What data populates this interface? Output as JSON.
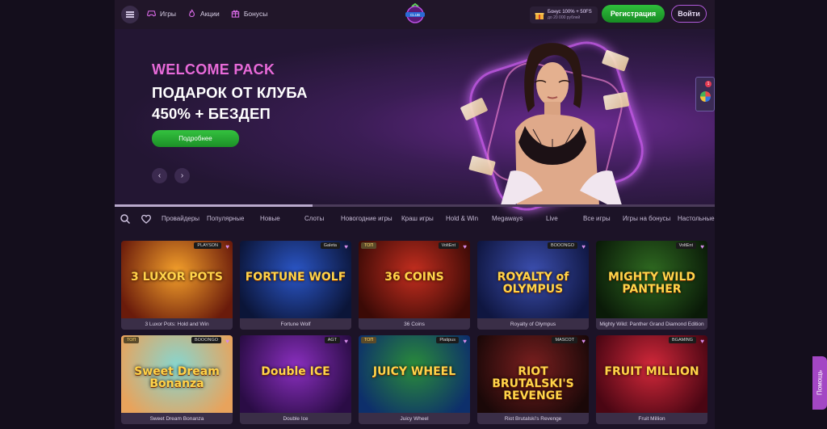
{
  "header": {
    "nav": [
      {
        "label": "Игры",
        "icon": "gamepad-icon"
      },
      {
        "label": "Акции",
        "icon": "flame-icon"
      },
      {
        "label": "Бонусы",
        "icon": "gift-icon"
      }
    ],
    "bonus": {
      "line1": "Бонус 100% + 50FS",
      "line2": "до 20 000 рублей"
    },
    "register_label": "Регистрация",
    "login_label": "Войти"
  },
  "hero": {
    "kicker": "WELCOME PACK",
    "title_line1": "ПОДАРОК ОТ КЛУБА",
    "title_line2": "450% + БЕЗДЕП",
    "cta_label": "Подробнее",
    "prev": "‹",
    "next": "›",
    "progress": 0.33,
    "widget_badge": "1"
  },
  "tabs": [
    "Провайдеры",
    "Популярные",
    "Новые",
    "Слоты",
    "Новогодние игры",
    "Краш игры",
    "Hold & Win",
    "Megaways",
    "Live",
    "Все игры",
    "Игры на бонусы",
    "Настольные"
  ],
  "games": [
    {
      "name": "3 Luxor Pots: Hold and Win",
      "art": "3 LUXOR POTS",
      "provider": "PLAYSON",
      "tag": "",
      "colors": [
        "#f4a02b",
        "#6a1b0b"
      ]
    },
    {
      "name": "Fortune Wolf",
      "art": "FORTUNE WOLF",
      "provider": "Galeta",
      "tag": "",
      "colors": [
        "#2b56c7",
        "#0b1538"
      ]
    },
    {
      "name": "36 Coins",
      "art": "36 COINS",
      "provider": "VoltEnt",
      "tag": "ТОП",
      "colors": [
        "#c42e1f",
        "#3b0a06"
      ]
    },
    {
      "name": "Royalty of Olympus",
      "art": "ROYALTY of OLYMPUS",
      "provider": "BOOONGO",
      "tag": "",
      "colors": [
        "#3c4fb0",
        "#0f1640"
      ]
    },
    {
      "name": "Mighty Wild: Panther Grand Diamond Edition",
      "art": "MIGHTY WILD PANTHER",
      "provider": "VoltEnt",
      "tag": "",
      "colors": [
        "#2f6a21",
        "#0a1a08"
      ]
    },
    {
      "name": "Sweet Dream Bonanza",
      "art": "Sweet Dream Bonanza",
      "provider": "BOOONGO",
      "tag": "ТОП",
      "colors": [
        "#86d6d0",
        "#e8a35c"
      ]
    },
    {
      "name": "Double Ice",
      "art": "Double ICE",
      "provider": "AGT",
      "tag": "",
      "colors": [
        "#8a2fbf",
        "#2a0c45"
      ]
    },
    {
      "name": "Juicy Wheel",
      "art": "JUICY WHEEL",
      "provider": "Platipus",
      "tag": "ТОП",
      "colors": [
        "#2a8c3a",
        "#0d2f6b"
      ]
    },
    {
      "name": "Riot Brutalski's Revenge",
      "art": "RIOT BRUTALSKI'S REVENGE",
      "provider": "MASCOT",
      "tag": "",
      "colors": [
        "#7a1f1f",
        "#1a0808"
      ]
    },
    {
      "name": "Fruit Million",
      "art": "FRUIT MILLION",
      "provider": "BGAMING",
      "tag": "",
      "colors": [
        "#d2283a",
        "#4a0613"
      ]
    }
  ],
  "help_label": "Помощь"
}
